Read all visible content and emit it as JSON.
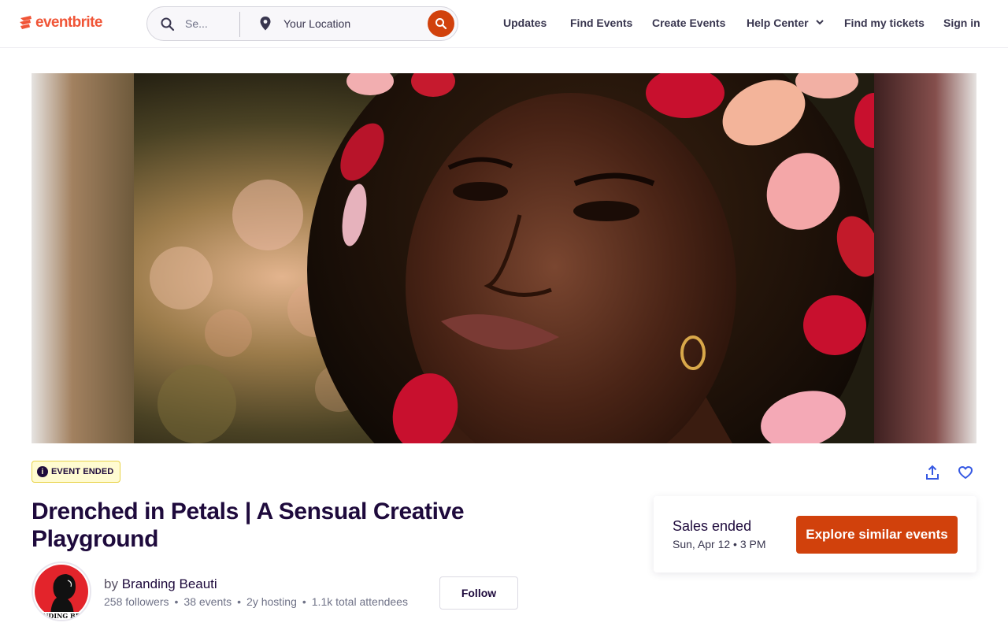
{
  "header": {
    "logo_text": "eventbrite",
    "search_placeholder": "Se...",
    "location_placeholder": "Your Location",
    "nav": {
      "updates": "Updates",
      "find_events": "Find Events",
      "create_events": "Create Events",
      "help_center": "Help Center",
      "find_tickets": "Find my tickets",
      "sign_in": "Sign in"
    }
  },
  "event": {
    "status_badge": "EVENT ENDED",
    "title": "Drenched in Petals | A Sensual Creative Playground",
    "organizer": {
      "by_prefix": "by",
      "name": "Branding Beauti",
      "followers": "258 followers",
      "events": "38 events",
      "hosting": "2y hosting",
      "attendees": "1.1k total attendees",
      "follow_label": "Follow"
    },
    "sales": {
      "status": "Sales ended",
      "date": "Sun, Apr 12 • 3 PM",
      "cta": "Explore similar events"
    }
  },
  "colors": {
    "brand": "#f05537",
    "cta": "#d1410c",
    "text": "#1e0a3c",
    "badge_bg": "#fffbd1"
  },
  "icons": [
    "eventbrite-logo-icon",
    "search-icon",
    "location-pin-icon",
    "chevron-down-icon",
    "info-icon",
    "share-icon",
    "heart-icon"
  ]
}
